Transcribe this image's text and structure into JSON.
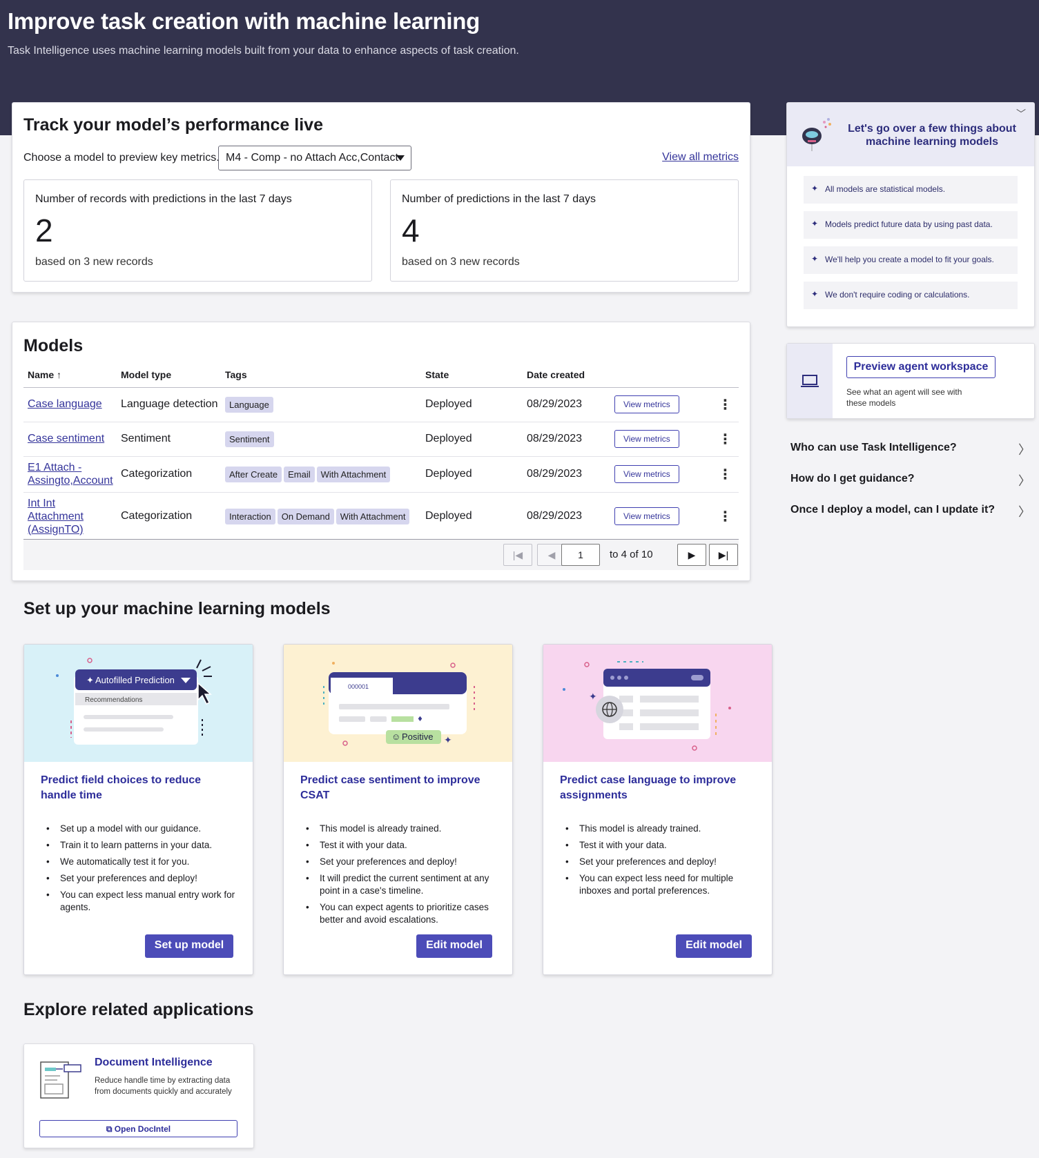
{
  "hero": {
    "title": "Improve task creation with machine learning",
    "subtitle": "Task Intelligence uses machine learning models built from your data to enhance aspects of task creation."
  },
  "performance": {
    "title": "Track your model’s performance live",
    "choose_label": "Choose a model to preview key metrics.",
    "selected_model": "M4 - Comp - no Attach Acc,Contact",
    "view_all": "View all metrics",
    "metrics": [
      {
        "label": "Number of records with predictions in the last 7 days",
        "value": "2",
        "sub": "based on 3 new records"
      },
      {
        "label": "Number of predictions in the last 7 days",
        "value": "4",
        "sub": "based on 3 new records"
      }
    ]
  },
  "models": {
    "title": "Models",
    "columns": {
      "name": "Name",
      "type": "Model type",
      "tags": "Tags",
      "state": "State",
      "date": "Date created"
    },
    "view_metrics_label": "View metrics",
    "rows": [
      {
        "name": "Case language",
        "type": "Language detection",
        "tags": [
          "Language"
        ],
        "state": "Deployed",
        "date": "08/29/2023"
      },
      {
        "name": "Case sentiment",
        "type": "Sentiment",
        "tags": [
          "Sentiment"
        ],
        "state": "Deployed",
        "date": "08/29/2023"
      },
      {
        "name": "E1 Attach - Assingto,Account",
        "type": "Categorization",
        "tags": [
          "After Create",
          "Email",
          "With Attachment"
        ],
        "state": "Deployed",
        "date": "08/29/2023"
      },
      {
        "name": "Int Int Attachment (AssignTO)",
        "type": "Categorization",
        "tags": [
          "Interaction",
          "On Demand",
          "With Attachment"
        ],
        "state": "Deployed",
        "date": "08/29/2023"
      }
    ],
    "pager": {
      "page": "1",
      "text": "to 4 of 10"
    }
  },
  "tips": {
    "title": "Let's go over a few things about machine learning models",
    "items": [
      "All models are statistical models.",
      "Models predict future data by using past data.",
      "We'll help you create a model to fit your goals.",
      "We don't require coding or calculations."
    ]
  },
  "preview": {
    "button": "Preview agent workspace",
    "desc": "See what an agent will see with these models"
  },
  "faq": [
    "Who can use Task Intelligence?",
    "How do I get guidance?",
    "Once I deploy a model, can I update it?"
  ],
  "setup": {
    "title": "Set up your machine learning models",
    "cards": [
      {
        "title": "Predict field choices to reduce handle time",
        "art": {
          "chip": "Autofilled Prediction",
          "sub": "Recommendations"
        },
        "bullets": [
          "Set up a model with our guidance.",
          "Train it to learn patterns in your data.",
          "We automatically test it for you.",
          "Set your preferences and deploy!",
          "You can expect less manual entry work for agents."
        ],
        "button": "Set up model"
      },
      {
        "title": "Predict case sentiment to improve CSAT",
        "art": {
          "record": "000001",
          "badge": "Positive"
        },
        "bullets": [
          "This model is already trained.",
          "Test it with your data.",
          "Set your preferences and deploy!",
          "It will predict the current sentiment at any point in a case's timeline.",
          "You can expect agents to prioritize cases better and avoid escalations."
        ],
        "button": "Edit model"
      },
      {
        "title": "Predict case language to improve assignments",
        "bullets": [
          "This model is already trained.",
          "Test it with your data.",
          "Set your preferences and deploy!",
          "You can expect less need for multiple inboxes and portal preferences."
        ],
        "button": "Edit model"
      }
    ]
  },
  "explore": {
    "title": "Explore related applications",
    "app": {
      "name": "Document Intelligence",
      "desc": "Reduce handle time by extracting data from documents quickly and accurately",
      "button": "Open DocIntel"
    }
  }
}
